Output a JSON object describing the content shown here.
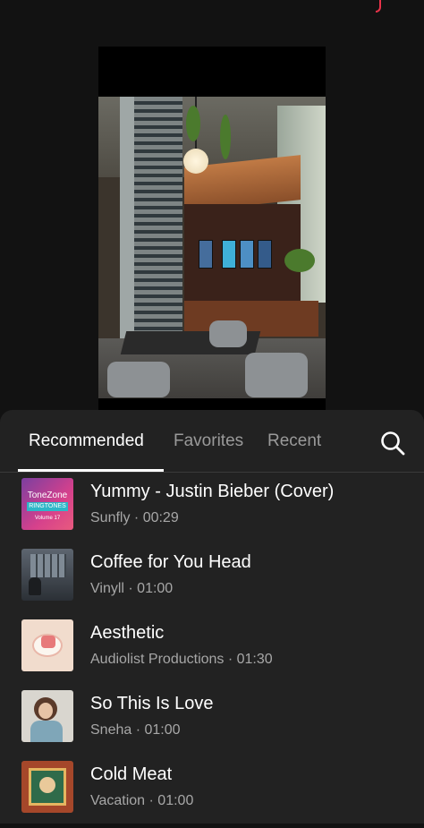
{
  "tabs": {
    "recommended": "Recommended",
    "favorites": "Favorites",
    "recent": "Recent",
    "active": "recommended"
  },
  "icons": {
    "search": "search-icon"
  },
  "tracks": [
    {
      "title": "Yummy - Justin Bieber (Cover)",
      "meta": "Sunfly · 00:29",
      "thumb_brand": "ToneZone",
      "thumb_band": "RINGTONES",
      "thumb_volume": "Volume 17"
    },
    {
      "title": "Coffee for You Head",
      "meta": "Vinyll · 01:00"
    },
    {
      "title": "Aesthetic",
      "meta": "Audiolist Productions · 01:30"
    },
    {
      "title": "So This Is Love",
      "meta": "Sneha · 01:00"
    },
    {
      "title": "Cold Meat",
      "meta": "Vacation · 01:00"
    }
  ],
  "colors": {
    "background": "#121212",
    "sheet": "#222222",
    "text_primary": "#ffffff",
    "text_secondary": "#a7a7a7",
    "tab_inactive": "#9a9a9a"
  }
}
